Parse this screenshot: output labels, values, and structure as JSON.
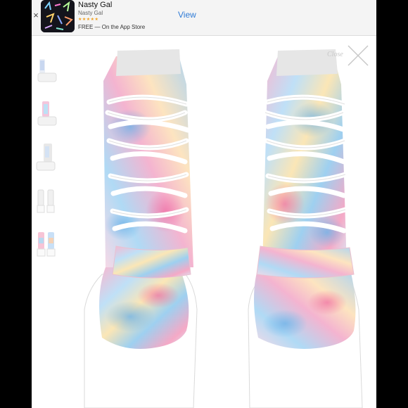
{
  "banner": {
    "close_glyph": "×",
    "app_name": "Nasty Gal",
    "developer": "Nasty Gal",
    "rating_stars": "★★★★★",
    "price_line": "FREE — On the App Store",
    "view_label": "View"
  },
  "gallery": {
    "close_label": "Close",
    "thumbnails": [
      "thumb-1",
      "thumb-2",
      "thumb-3",
      "thumb-4",
      "thumb-5"
    ]
  },
  "colors": {
    "accent": "#2f7bd6",
    "banner_bg": "#f4f4f4",
    "close_gray": "#c8c8c8"
  }
}
